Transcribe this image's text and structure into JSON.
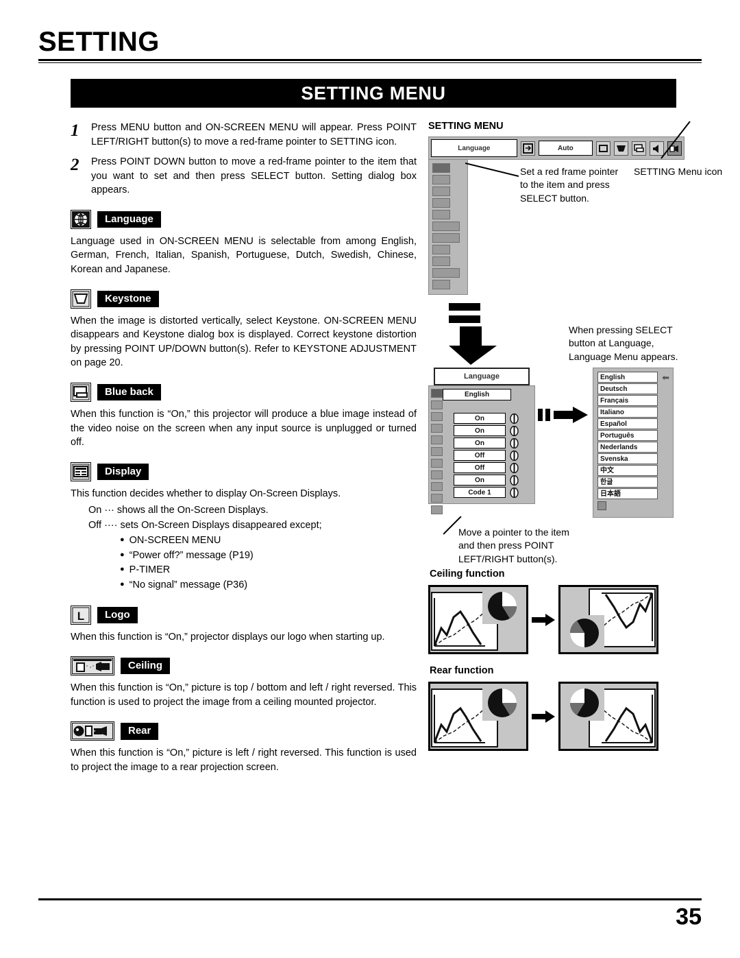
{
  "page": {
    "title": "SETTING",
    "banner": "SETTING MENU",
    "number": "35"
  },
  "steps": [
    {
      "num": "1",
      "text": "Press MENU button and ON-SCREEN MENU will appear.  Press POINT LEFT/RIGHT button(s) to move a red-frame pointer to SETTING icon."
    },
    {
      "num": "2",
      "text": "Press POINT DOWN button to move a red-frame pointer to the item that you want to set and then press SELECT button.  Setting dialog box appears."
    }
  ],
  "sections": [
    {
      "icon": "globe-icon",
      "label": "Language",
      "body": "Language used in ON-SCREEN MENU is selectable from among English, German, French, Italian, Spanish, Portuguese, Dutch, Swedish, Chinese, Korean and Japanese."
    },
    {
      "icon": "keystone-icon",
      "label": "Keystone",
      "body": "When the image is distorted vertically, select Keystone.  ON-SCREEN MENU disappears and Keystone dialog box is displayed. Correct keystone distortion by pressing POINT UP/DOWN button(s). Refer to KEYSTONE ADJUSTMENT on page 20."
    },
    {
      "icon": "blue-back-icon",
      "label": "Blue back",
      "body": "When this function is “On,” this projector will produce a blue image instead of the video noise on the screen when any input source is unplugged or turned off."
    },
    {
      "icon": "display-icon",
      "label": "Display",
      "body": "This function decides whether to display On-Screen Displays."
    },
    {
      "icon": "logo-icon",
      "label": "Logo",
      "body": "When this function is “On,” projector displays our logo when starting up."
    },
    {
      "icon": "ceiling-icon",
      "label": "Ceiling",
      "body": "When this function is “On,” picture is top / bottom and left / right reversed.  This function is used to project the image from a ceiling mounted projector."
    },
    {
      "icon": "rear-icon",
      "label": "Rear",
      "body": "When this function is “On,” picture is left / right reversed.  This function is used to project the image to a rear projection screen."
    }
  ],
  "display_detail": {
    "on_line": "On  ··· shows all the On-Screen Displays.",
    "off_line": "Off ···· sets On-Screen Displays disappeared except;",
    "bullets": [
      "ON-SCREEN MENU",
      "“Power off?” message (P19)",
      "P-TIMER",
      "“No signal” message (P36)"
    ]
  },
  "right": {
    "menu_title": "SETTING MENU",
    "osd": {
      "language_label": "Language",
      "auto_label": "Auto"
    },
    "callout_select": "Set a red frame pointer to the item and press SELECT button.",
    "callout_menu_icon": "SETTING Menu icon",
    "callout_language_menu": "When pressing SELECT button at Language, Language Menu appears.",
    "callout_pointer": "Move a pointer to the item and then press POINT LEFT/RIGHT button(s).",
    "dialog": {
      "title": "Language",
      "language_value": "English",
      "values": [
        "On",
        "On",
        "On",
        "Off",
        "Off",
        "On",
        "Code 1"
      ]
    },
    "languages": [
      "English",
      "Deutsch",
      "Français",
      "Italiano",
      "Español",
      "Português",
      "Nederlands",
      "Svenska",
      "中文",
      "한글",
      "日本語"
    ],
    "ceiling_function_title": "Ceiling function",
    "rear_function_title": "Rear function"
  }
}
